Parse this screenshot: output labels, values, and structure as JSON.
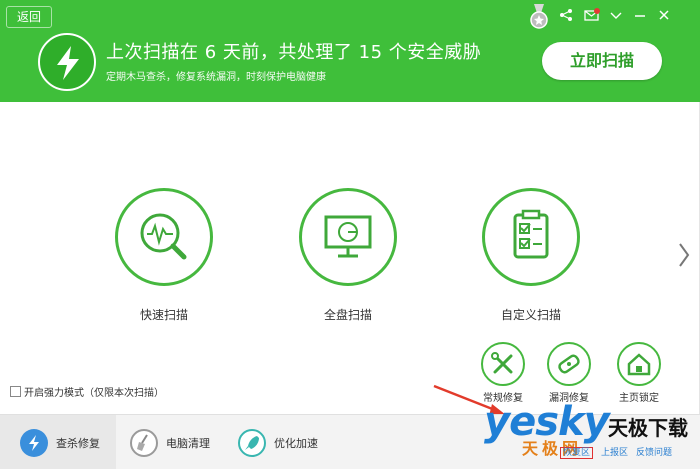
{
  "header": {
    "back_label": "返回",
    "headline": "上次扫描在 6 天前，共处理了 15 个安全威胁",
    "subline": "定期木马查杀，修复系统漏洞，时刻保护电脑健康",
    "scan_now_label": "立即扫描",
    "icons": [
      "share-icon",
      "mail-icon",
      "minimize-icon",
      "close-icon"
    ],
    "accent_color": "#3fbf3a"
  },
  "scan_options": [
    {
      "label": "快速扫描",
      "icon": "pulse-magnifier-icon"
    },
    {
      "label": "全盘扫描",
      "icon": "monitor-icon"
    },
    {
      "label": "自定义扫描",
      "icon": "clipboard-check-icon"
    }
  ],
  "small_tools": [
    {
      "label": "常规修复",
      "icon": "wrench-screwdriver-icon"
    },
    {
      "label": "漏洞修复",
      "icon": "bandage-shield-icon"
    },
    {
      "label": "主页锁定",
      "icon": "home-lock-icon"
    }
  ],
  "force_mode": {
    "label": "开启强力模式（仅限本次扫描）",
    "checked": false
  },
  "tabs": [
    {
      "label": "查杀修复",
      "icon": "bolt-icon",
      "active": true
    },
    {
      "label": "电脑清理",
      "icon": "broom-icon",
      "active": false
    },
    {
      "label": "优化加速",
      "icon": "rocket-icon",
      "active": false
    }
  ],
  "watermark": {
    "logo": "yesky",
    "brand": "天极下载",
    "net": "天极网",
    "links": [
      "恢复区",
      "上报区",
      "反馈问题"
    ]
  }
}
